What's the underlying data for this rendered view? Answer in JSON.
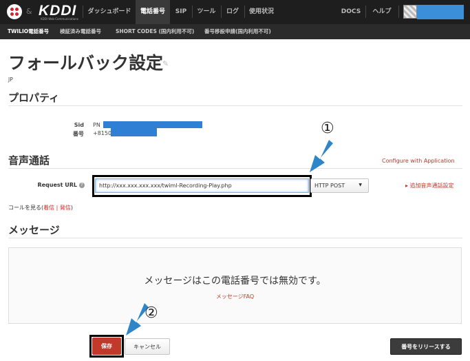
{
  "topnav": {
    "logo_amp": "&",
    "brand": "KDDI",
    "brand_sub": "KDDI Web Communications",
    "items": [
      "ダッシュボード",
      "電話番号",
      "SIP",
      "ツール",
      "ログ",
      "使用状況"
    ],
    "active_index": 1,
    "right_items": [
      "DOCS",
      "ヘルプ"
    ]
  },
  "subnav": {
    "items": [
      "TWILIO電話番号",
      "検証済み電話番号",
      "SHORT CODES (国内利用不可)",
      "番号移設申請(国内利用不可)"
    ],
    "active_index": 0
  },
  "page": {
    "title": "フォールバック設定",
    "country": "JP"
  },
  "properties": {
    "heading": "プロパティ",
    "sid_label": "Sid",
    "sid_value": "PN",
    "number_label": "番号",
    "number_value": "+8150"
  },
  "voice": {
    "heading": "音声通話",
    "config_link": "Configure with Application",
    "request_url_label": "Request URL",
    "help_icon": "?",
    "request_url_value": "http://xxx.xxx.xxx.xxx/twiml-Recording-Play.php",
    "method_value": "HTTP POST",
    "method_caret": "▼",
    "add_setting_link": "▸ 追加音声通話設定",
    "call_log_text": "コールを見る(",
    "incoming_link": "着信",
    "separator": " | ",
    "outgoing_link": "発信",
    "close_paren": ")"
  },
  "message": {
    "heading": "メッセージ",
    "disabled_text": "メッセージはこの電話番号では無効です。",
    "faq_link": "メッセージFAQ"
  },
  "actions": {
    "save_label": "保存",
    "cancel_label": "キャンセル",
    "release_label": "番号をリリースする"
  },
  "annotations": {
    "callout_1": "①",
    "callout_2": "②",
    "arrow_color": "#2e86c9"
  },
  "colors": {
    "accent_red": "#c0392b",
    "nav_bg": "#1e1e1e",
    "redaction_blue": "#2f7fd4"
  }
}
